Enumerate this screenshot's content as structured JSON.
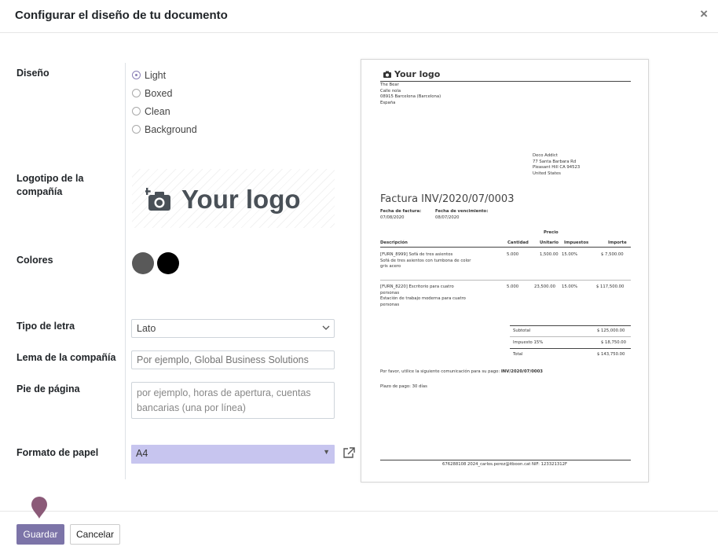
{
  "modal": {
    "title": "Configurar el diseño de tu documento",
    "close": "×"
  },
  "labels": {
    "diseno": "Diseño",
    "logotipo_1": "Logotipo de la",
    "logotipo_2": "compañía",
    "colores": "Colores",
    "tipo_letra": "Tipo de letra",
    "lema": "Lema de la compañía",
    "pie": "Pie de página",
    "formato": "Formato de papel"
  },
  "layout_options": [
    {
      "label": "Light",
      "checked": true
    },
    {
      "label": "Boxed",
      "checked": false
    },
    {
      "label": "Clean",
      "checked": false
    },
    {
      "label": "Background",
      "checked": false
    }
  ],
  "logo_text": "Your logo",
  "colors": {
    "primary": "#595959",
    "secondary": "#000000",
    "accent": "#7c74a8"
  },
  "font_select": {
    "value": "Lato"
  },
  "tagline": {
    "placeholder": "Por ejemplo, Global Business Solutions"
  },
  "footer_field": {
    "placeholder_1": "por ejemplo, horas de apertura, cuentas",
    "placeholder_2": "bancarias (una por línea)"
  },
  "paper_format": {
    "value": "A4"
  },
  "preview": {
    "logo": "Your logo",
    "company_address": [
      "The Bear",
      "Calle nola",
      "08915 Barcelona (Barcelona)",
      "España"
    ],
    "customer_address": [
      "Deco Addict",
      "77 Santa Barbara Rd",
      "Pleasant Hill CA 94523",
      "United States"
    ],
    "invoice_title": "Factura INV/2020/07/0003",
    "invoice_date_label": "Fecha de factura:",
    "invoice_date": "07/08/2020",
    "due_date_label": "Fecha de vencimiento:",
    "due_date": "08/07/2020",
    "columns": {
      "desc": "Descripción",
      "qty": "Cantidad",
      "price_1": "Precio",
      "price_2": "Unitario",
      "taxes": "Impuestos",
      "amount": "Importe"
    },
    "lines": [
      {
        "desc_1": "[FURN_8999] Sofá de tres asientos",
        "desc_2": "Sofá de tres asientos con tumbona de color",
        "desc_3": "gris acero",
        "qty": "5.000",
        "price": "1,500.00",
        "tax": "15.00%",
        "amount": "$ 7,500.00"
      },
      {
        "desc_1": "[FURN_8220] Escritorio para cuatro",
        "desc_2": "personas",
        "desc_3": "Estación de trabajo moderna para cuatro",
        "desc_4": "personas",
        "qty": "5.000",
        "price": "23,500.00",
        "tax": "15.00%",
        "amount": "$ 117,500.00"
      }
    ],
    "totals": [
      {
        "label": "Subtotal",
        "value": "$ 125,000.00"
      },
      {
        "label": "Impuesto 15%",
        "value": "$ 18,750.00"
      },
      {
        "label": "Total",
        "value": "$ 143,750.00"
      }
    ],
    "payment_comm": "Por favor, utilice la siguiente comunicación para su pago: ",
    "payment_ref": "INV/2020/07/0003",
    "payment_terms": "Plazo de pago: 30 días",
    "footer": "676288108  2024_carlos.perez@itboon.cat  NIF: 123321312F"
  },
  "buttons": {
    "save": "Guardar",
    "cancel": "Cancelar"
  }
}
